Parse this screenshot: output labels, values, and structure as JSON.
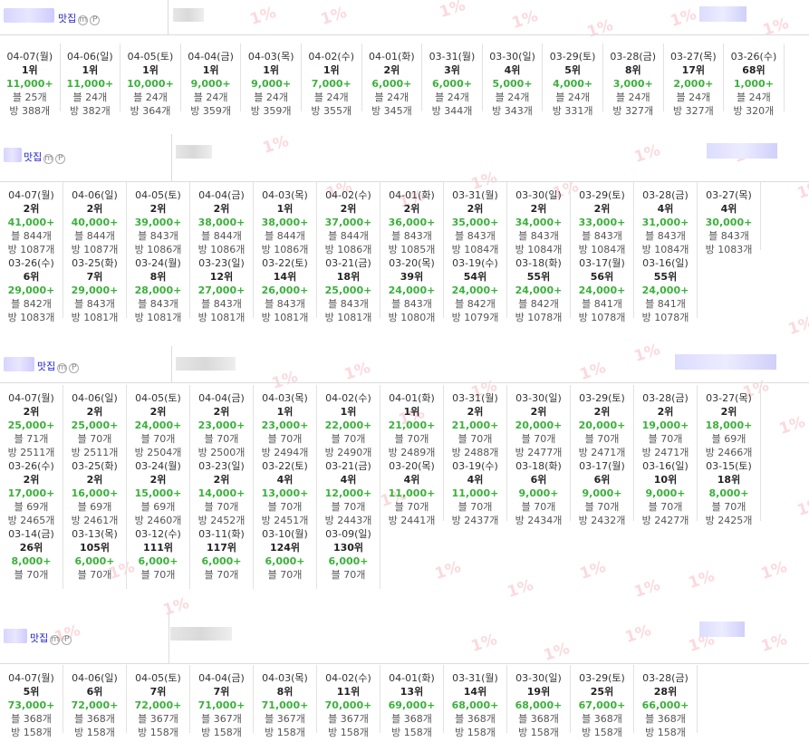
{
  "watermark": "1%",
  "sections": [
    {
      "title": "맛집",
      "entries": [
        {
          "date": "04-07(월)",
          "rank": "1위",
          "value": "11,000+",
          "blog": "블 25개",
          "bang": "방 388개"
        },
        {
          "date": "04-06(일)",
          "rank": "1위",
          "value": "11,000+",
          "blog": "블 24개",
          "bang": "방 382개"
        },
        {
          "date": "04-05(토)",
          "rank": "1위",
          "value": "10,000+",
          "blog": "블 24개",
          "bang": "방 364개"
        },
        {
          "date": "04-04(금)",
          "rank": "1위",
          "value": "9,000+",
          "blog": "블 24개",
          "bang": "방 359개"
        },
        {
          "date": "04-03(목)",
          "rank": "1위",
          "value": "9,000+",
          "blog": "블 24개",
          "bang": "방 359개"
        },
        {
          "date": "04-02(수)",
          "rank": "1위",
          "value": "7,000+",
          "blog": "블 24개",
          "bang": "방 355개"
        },
        {
          "date": "04-01(화)",
          "rank": "2위",
          "value": "6,000+",
          "blog": "블 24개",
          "bang": "방 345개"
        },
        {
          "date": "03-31(월)",
          "rank": "3위",
          "value": "6,000+",
          "blog": "블 24개",
          "bang": "방 344개"
        },
        {
          "date": "03-30(일)",
          "rank": "4위",
          "value": "5,000+",
          "blog": "블 24개",
          "bang": "방 343개"
        },
        {
          "date": "03-29(토)",
          "rank": "5위",
          "value": "4,000+",
          "blog": "블 24개",
          "bang": "방 331개"
        },
        {
          "date": "03-28(금)",
          "rank": "8위",
          "value": "3,000+",
          "blog": "블 24개",
          "bang": "방 327개"
        },
        {
          "date": "03-27(목)",
          "rank": "17위",
          "value": "2,000+",
          "blog": "블 24개",
          "bang": "방 327개"
        },
        {
          "date": "03-26(수)",
          "rank": "68위",
          "value": "1,000+",
          "blog": "블 24개",
          "bang": "방 320개"
        }
      ]
    },
    {
      "title": "맛집",
      "entries": [
        {
          "date": "04-07(월)",
          "rank": "2위",
          "value": "41,000+",
          "blog": "블 844개",
          "bang": "방 1087개"
        },
        {
          "date": "04-06(일)",
          "rank": "2위",
          "value": "40,000+",
          "blog": "블 844개",
          "bang": "방 1087개"
        },
        {
          "date": "04-05(토)",
          "rank": "2위",
          "value": "39,000+",
          "blog": "블 843개",
          "bang": "방 1086개"
        },
        {
          "date": "04-04(금)",
          "rank": "2위",
          "value": "38,000+",
          "blog": "블 844개",
          "bang": "방 1086개"
        },
        {
          "date": "04-03(목)",
          "rank": "1위",
          "value": "38,000+",
          "blog": "블 844개",
          "bang": "방 1086개"
        },
        {
          "date": "04-02(수)",
          "rank": "2위",
          "value": "37,000+",
          "blog": "블 844개",
          "bang": "방 1086개"
        },
        {
          "date": "04-01(화)",
          "rank": "2위",
          "value": "36,000+",
          "blog": "블 843개",
          "bang": "방 1085개"
        },
        {
          "date": "03-31(월)",
          "rank": "2위",
          "value": "35,000+",
          "blog": "블 843개",
          "bang": "방 1084개"
        },
        {
          "date": "03-30(일)",
          "rank": "2위",
          "value": "34,000+",
          "blog": "블 843개",
          "bang": "방 1084개"
        },
        {
          "date": "03-29(토)",
          "rank": "2위",
          "value": "33,000+",
          "blog": "블 843개",
          "bang": "방 1084개"
        },
        {
          "date": "03-28(금)",
          "rank": "4위",
          "value": "31,000+",
          "blog": "블 843개",
          "bang": "방 1084개"
        },
        {
          "date": "03-27(목)",
          "rank": "4위",
          "value": "30,000+",
          "blog": "블 843개",
          "bang": "방 1083개"
        },
        {
          "date": "03-26(수)",
          "rank": "6위",
          "value": "29,000+",
          "blog": "블 842개",
          "bang": "방 1083개"
        },
        {
          "date": "03-25(화)",
          "rank": "7위",
          "value": "29,000+",
          "blog": "블 843개",
          "bang": "방 1081개"
        },
        {
          "date": "03-24(월)",
          "rank": "8위",
          "value": "28,000+",
          "blog": "블 843개",
          "bang": "방 1081개"
        },
        {
          "date": "03-23(일)",
          "rank": "12위",
          "value": "27,000+",
          "blog": "블 843개",
          "bang": "방 1081개"
        },
        {
          "date": "03-22(토)",
          "rank": "14위",
          "value": "26,000+",
          "blog": "블 843개",
          "bang": "방 1081개"
        },
        {
          "date": "03-21(금)",
          "rank": "18위",
          "value": "25,000+",
          "blog": "블 843개",
          "bang": "방 1081개"
        },
        {
          "date": "03-20(목)",
          "rank": "39위",
          "value": "24,000+",
          "blog": "블 843개",
          "bang": "방 1080개"
        },
        {
          "date": "03-19(수)",
          "rank": "54위",
          "value": "24,000+",
          "blog": "블 842개",
          "bang": "방 1079개"
        },
        {
          "date": "03-18(화)",
          "rank": "55위",
          "value": "24,000+",
          "blog": "블 842개",
          "bang": "방 1078개"
        },
        {
          "date": "03-17(월)",
          "rank": "56위",
          "value": "24,000+",
          "blog": "블 841개",
          "bang": "방 1078개"
        },
        {
          "date": "03-16(일)",
          "rank": "55위",
          "value": "24,000+",
          "blog": "블 841개",
          "bang": "방 1078개"
        }
      ]
    },
    {
      "title": "맛집",
      "entries": [
        {
          "date": "04-07(월)",
          "rank": "2위",
          "value": "25,000+",
          "blog": "블 71개",
          "bang": "방 2511개"
        },
        {
          "date": "04-06(일)",
          "rank": "2위",
          "value": "25,000+",
          "blog": "블 70개",
          "bang": "방 2511개"
        },
        {
          "date": "04-05(토)",
          "rank": "2위",
          "value": "24,000+",
          "blog": "블 70개",
          "bang": "방 2504개"
        },
        {
          "date": "04-04(금)",
          "rank": "2위",
          "value": "23,000+",
          "blog": "블 70개",
          "bang": "방 2500개"
        },
        {
          "date": "04-03(목)",
          "rank": "1위",
          "value": "23,000+",
          "blog": "블 70개",
          "bang": "방 2494개"
        },
        {
          "date": "04-02(수)",
          "rank": "1위",
          "value": "22,000+",
          "blog": "블 70개",
          "bang": "방 2490개"
        },
        {
          "date": "04-01(화)",
          "rank": "1위",
          "value": "21,000+",
          "blog": "블 70개",
          "bang": "방 2489개"
        },
        {
          "date": "03-31(월)",
          "rank": "2위",
          "value": "21,000+",
          "blog": "블 70개",
          "bang": "방 2488개"
        },
        {
          "date": "03-30(일)",
          "rank": "2위",
          "value": "20,000+",
          "blog": "블 70개",
          "bang": "방 2477개"
        },
        {
          "date": "03-29(토)",
          "rank": "2위",
          "value": "20,000+",
          "blog": "블 70개",
          "bang": "방 2471개"
        },
        {
          "date": "03-28(금)",
          "rank": "2위",
          "value": "19,000+",
          "blog": "블 70개",
          "bang": "방 2471개"
        },
        {
          "date": "03-27(목)",
          "rank": "2위",
          "value": "18,000+",
          "blog": "블 69개",
          "bang": "방 2466개"
        },
        {
          "date": "03-26(수)",
          "rank": "2위",
          "value": "17,000+",
          "blog": "블 69개",
          "bang": "방 2465개"
        },
        {
          "date": "03-25(화)",
          "rank": "2위",
          "value": "16,000+",
          "blog": "블 69개",
          "bang": "방 2461개"
        },
        {
          "date": "03-24(월)",
          "rank": "2위",
          "value": "15,000+",
          "blog": "블 69개",
          "bang": "방 2460개"
        },
        {
          "date": "03-23(일)",
          "rank": "2위",
          "value": "14,000+",
          "blog": "블 70개",
          "bang": "방 2452개"
        },
        {
          "date": "03-22(토)",
          "rank": "4위",
          "value": "13,000+",
          "blog": "블 70개",
          "bang": "방 2451개"
        },
        {
          "date": "03-21(금)",
          "rank": "4위",
          "value": "12,000+",
          "blog": "블 70개",
          "bang": "방 2443개"
        },
        {
          "date": "03-20(목)",
          "rank": "4위",
          "value": "11,000+",
          "blog": "블 70개",
          "bang": "방 2441개"
        },
        {
          "date": "03-19(수)",
          "rank": "4위",
          "value": "11,000+",
          "blog": "블 70개",
          "bang": "방 2437개"
        },
        {
          "date": "03-18(화)",
          "rank": "6위",
          "value": "9,000+",
          "blog": "블 70개",
          "bang": "방 2434개"
        },
        {
          "date": "03-17(월)",
          "rank": "6위",
          "value": "9,000+",
          "blog": "블 70개",
          "bang": "방 2432개"
        },
        {
          "date": "03-16(일)",
          "rank": "10위",
          "value": "9,000+",
          "blog": "블 70개",
          "bang": "방 2427개"
        },
        {
          "date": "03-15(토)",
          "rank": "18위",
          "value": "8,000+",
          "blog": "블 70개",
          "bang": "방 2425개"
        },
        {
          "date": "03-14(금)",
          "rank": "26위",
          "value": "8,000+",
          "blog": "블 70개",
          "bang": ""
        },
        {
          "date": "03-13(목)",
          "rank": "105위",
          "value": "6,000+",
          "blog": "블 70개",
          "bang": ""
        },
        {
          "date": "03-12(수)",
          "rank": "111위",
          "value": "6,000+",
          "blog": "블 70개",
          "bang": ""
        },
        {
          "date": "03-11(화)",
          "rank": "117위",
          "value": "6,000+",
          "blog": "블 70개",
          "bang": ""
        },
        {
          "date": "03-10(월)",
          "rank": "124위",
          "value": "6,000+",
          "blog": "블 70개",
          "bang": ""
        },
        {
          "date": "03-09(일)",
          "rank": "130위",
          "value": "6,000+",
          "blog": "블 70개",
          "bang": ""
        }
      ]
    },
    {
      "title": "맛집",
      "entries": [
        {
          "date": "04-07(월)",
          "rank": "5위",
          "value": "73,000+",
          "blog": "블 368개",
          "bang": "방 158개"
        },
        {
          "date": "04-06(일)",
          "rank": "6위",
          "value": "72,000+",
          "blog": "블 368개",
          "bang": "방 158개"
        },
        {
          "date": "04-05(토)",
          "rank": "7위",
          "value": "72,000+",
          "blog": "블 367개",
          "bang": "방 158개"
        },
        {
          "date": "04-04(금)",
          "rank": "7위",
          "value": "71,000+",
          "blog": "블 367개",
          "bang": "방 158개"
        },
        {
          "date": "04-03(목)",
          "rank": "8위",
          "value": "71,000+",
          "blog": "블 367개",
          "bang": "방 158개"
        },
        {
          "date": "04-02(수)",
          "rank": "11위",
          "value": "70,000+",
          "blog": "블 367개",
          "bang": "방 158개"
        },
        {
          "date": "04-01(화)",
          "rank": "13위",
          "value": "69,000+",
          "blog": "블 368개",
          "bang": "방 158개"
        },
        {
          "date": "03-31(월)",
          "rank": "14위",
          "value": "68,000+",
          "blog": "블 368개",
          "bang": "방 158개"
        },
        {
          "date": "03-30(일)",
          "rank": "19위",
          "value": "68,000+",
          "blog": "블 368개",
          "bang": "방 158개"
        },
        {
          "date": "03-29(토)",
          "rank": "25위",
          "value": "67,000+",
          "blog": "블 368개",
          "bang": "방 158개"
        },
        {
          "date": "03-28(금)",
          "rank": "28위",
          "value": "66,000+",
          "blog": "블 368개",
          "bang": "방 158개"
        }
      ]
    }
  ]
}
